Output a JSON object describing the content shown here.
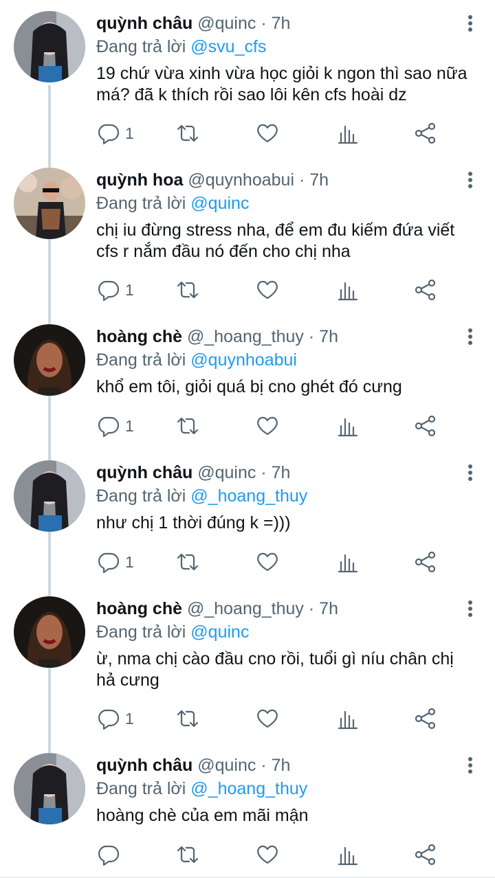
{
  "tweets": [
    {
      "name": "quỳnh châu",
      "handle": "@quinc",
      "dot": "·",
      "time": "7h",
      "reply_prefix": "Đang trả lời",
      "reply_to": "@svu_cfs",
      "text": "19 chứ vừa xinh vừa học giỏi k ngon thì sao nữa má? đã k thích rồi sao lôi kên cfs hoài dz",
      "reply_count": "1"
    },
    {
      "name": "quỳnh hoa",
      "handle": "@quynhoabui",
      "dot": "·",
      "time": "7h",
      "reply_prefix": "Đang trả lời",
      "reply_to": "@quinc",
      "text": "chị iu đừng stress nha, để em đu kiếm đứa viết cfs r nắm đầu nó đến cho chị nha",
      "reply_count": "1"
    },
    {
      "name": "hoàng chè",
      "handle": "@_hoang_thuy",
      "dot": "·",
      "time": "7h",
      "reply_prefix": "Đang trả lời",
      "reply_to": "@quynhoabui",
      "text": "khổ em tôi, giỏi quá bị cno ghét đó cưng",
      "reply_count": "1"
    },
    {
      "name": "quỳnh châu",
      "handle": "@quinc",
      "dot": "·",
      "time": "7h",
      "reply_prefix": "Đang trả lời",
      "reply_to": "@_hoang_thuy",
      "text": "như chị 1 thời đúng k =)))",
      "reply_count": "1"
    },
    {
      "name": "hoàng chè",
      "handle": "@_hoang_thuy",
      "dot": "·",
      "time": "7h",
      "reply_prefix": "Đang trả lời",
      "reply_to": "@quinc",
      "text": "ừ, nma chị cào đầu cno rồi, tuổi gì níu chân chị hả cưng",
      "reply_count": "1"
    },
    {
      "name": "quỳnh châu",
      "handle": "@quinc",
      "dot": "·",
      "time": "7h",
      "reply_prefix": "Đang trả lời",
      "reply_to": "@_hoang_thuy",
      "text": "hoàng chè của em mãi mận",
      "reply_count": ""
    }
  ],
  "icons": {
    "reply": "reply-icon",
    "retweet": "retweet-icon",
    "like": "heart-icon",
    "stats": "stats-icon",
    "share": "share-icon",
    "more": "more-vertical-icon"
  },
  "colors": {
    "link": "#1d9bf0",
    "secondary": "#536471",
    "thread_line": "#cfd9de"
  }
}
